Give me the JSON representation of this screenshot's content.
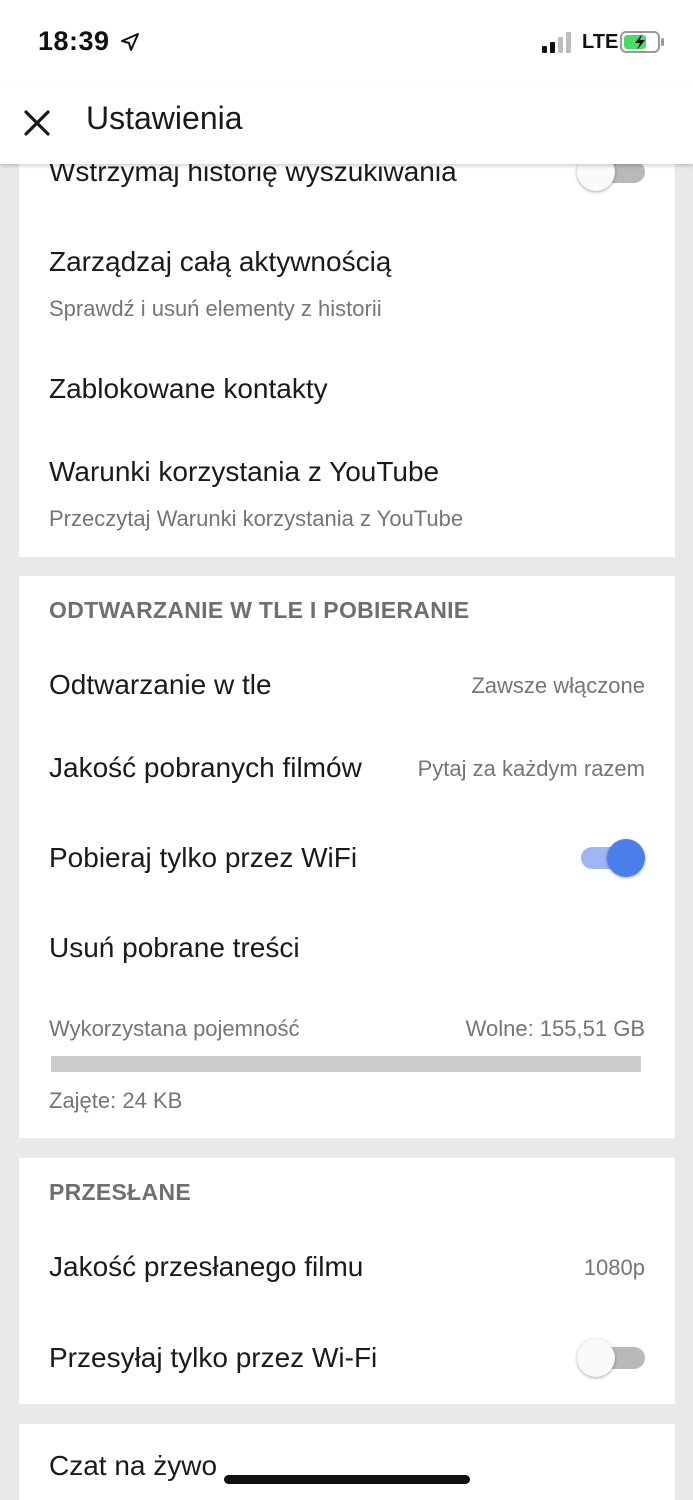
{
  "status_bar": {
    "time": "18:39",
    "network": "LTE",
    "icons": [
      "location-arrow-icon",
      "cellular-signal-icon",
      "battery-charging-icon"
    ]
  },
  "app_bar": {
    "title": "Ustawienia",
    "close_icon": "close-icon"
  },
  "history_section": {
    "pause_search": {
      "label": "Wstrzymaj historię wyszukiwania",
      "enabled": false
    },
    "manage_activity": {
      "label": "Zarządzaj całą aktywnością",
      "subtitle": "Sprawdź i usuń elementy z historii"
    },
    "blocked_contacts": {
      "label": "Zablokowane kontakty"
    },
    "terms": {
      "label": "Warunki korzystania z YouTube",
      "subtitle": "Przeczytaj Warunki korzystania z YouTube"
    }
  },
  "downloads_section": {
    "header": "ODTWARZANIE W TLE I POBIERANIE",
    "background_play": {
      "label": "Odtwarzanie w tle",
      "value": "Zawsze włączone"
    },
    "download_quality": {
      "label": "Jakość pobranych filmów",
      "value": "Pytaj za każdym razem"
    },
    "wifi_only": {
      "label": "Pobieraj tylko przez WiFi",
      "enabled": true
    },
    "delete_downloads": {
      "label": "Usuń pobrane treści"
    },
    "storage": {
      "label": "Wykorzystana pojemność",
      "free": "Wolne: 155,51 GB",
      "used": "Zajęte: 24 KB",
      "used_fraction": 0.0
    }
  },
  "uploads_section": {
    "header": "PRZESŁANE",
    "upload_quality": {
      "label": "Jakość przesłanego filmu",
      "value": "1080p"
    },
    "wifi_only": {
      "label": "Przesyłaj tylko przez Wi-Fi",
      "enabled": false
    }
  },
  "live_chat_section": {
    "label": "Czat na żywo"
  },
  "colors": {
    "accent": "#4a7ee8",
    "accent_track": "#9fb6f5",
    "background": "#e9e9e9",
    "secondary_text": "#757575"
  }
}
